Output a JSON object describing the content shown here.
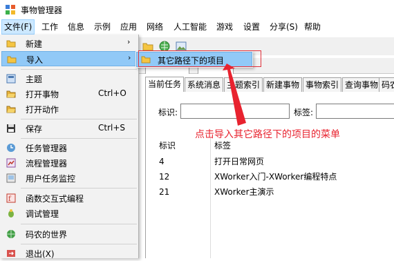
{
  "window": {
    "title": "事物管理器"
  },
  "menubar": [
    "文件(F)",
    "工作",
    "信息",
    "示例",
    "应用",
    "网络",
    "人工智能",
    "游戏",
    "设置",
    "分享(S)",
    "帮助"
  ],
  "file_menu": {
    "new": "新建",
    "import": "导入",
    "theme": "主题",
    "open_thing": "打开事物",
    "open_thing_sc": "Ctrl+O",
    "open_action": "打开动作",
    "save": "保存",
    "save_sc": "Ctrl+S",
    "task_manager": "任务管理器",
    "process_manager": "流程管理器",
    "user_task_monitor": "用户任务监控",
    "func_programming": "函数交互式编程",
    "debug_manager": "调试管理",
    "coder_world": "码农的世界",
    "exit": "退出(X)"
  },
  "submenu": {
    "other_path_projects": "其它路径下的项目"
  },
  "bg_tabs": [
    "当前任务",
    "系统消息",
    "主题索引",
    "新建事物",
    "事物索引",
    "查询事物",
    "码农"
  ],
  "filter": {
    "id_label": "标识:",
    "tag_label": "标签:"
  },
  "table": {
    "headers": [
      "标识",
      "标签"
    ],
    "rows": [
      [
        "4",
        "打开日常网页"
      ],
      [
        "12",
        "XWorker入门-XWorker编程特点"
      ],
      [
        "21",
        "XWorker主演示"
      ]
    ]
  },
  "annotation": {
    "text": "点击导入其它路径下的项目的菜单",
    "color": "#e8232f"
  },
  "colors": {
    "highlight": "#91c9f7",
    "menu_bg": "#f2f2f2"
  }
}
